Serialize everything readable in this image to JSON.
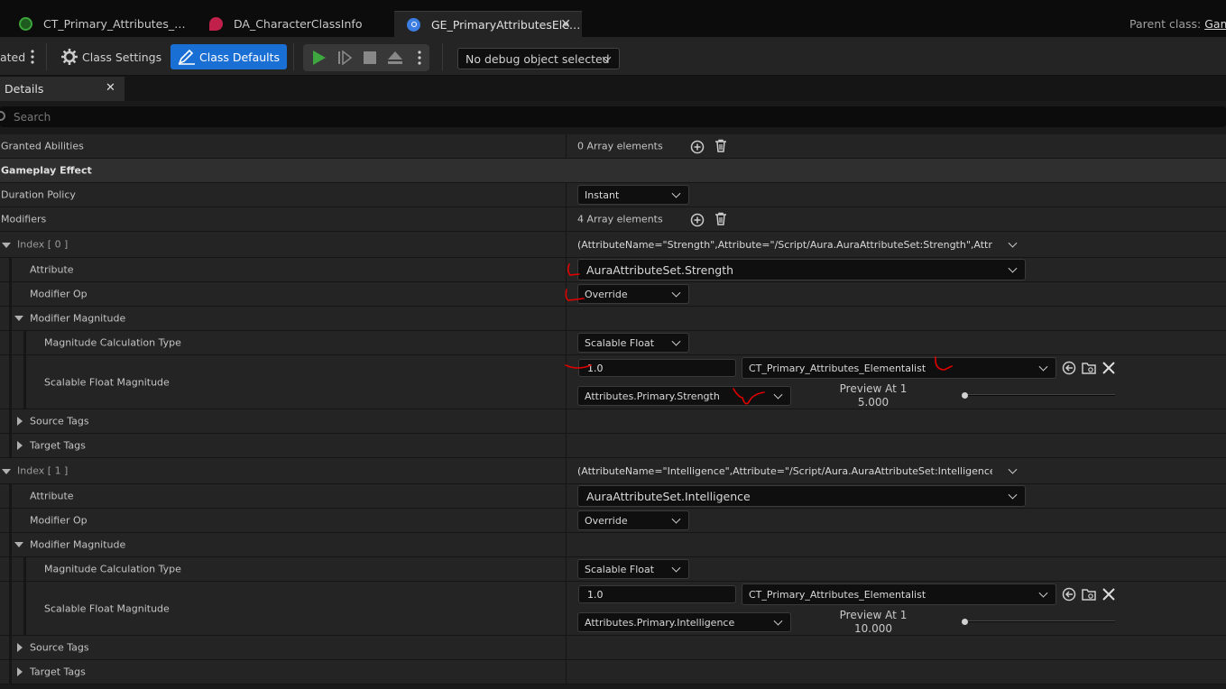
{
  "tabs": [
    {
      "label": "CT_Primary_Attributes_…",
      "icon": "curve-table-icon",
      "color": "#3aa53a"
    },
    {
      "label": "DA_CharacterClassInfo",
      "icon": "data-asset-icon",
      "color": "#c0204a"
    },
    {
      "label": "GE_PrimaryAttributesEle…",
      "icon": "blueprint-icon",
      "color": "#3b7de0",
      "active": true
    }
  ],
  "parent_class": {
    "label": "Parent class:",
    "value": "Gam"
  },
  "toolbar": {
    "cut_label": "ated",
    "class_settings": "Class Settings",
    "class_defaults": "Class Defaults",
    "debug_object": "No debug object selected"
  },
  "details": {
    "tab_label": "Details",
    "search_placeholder": "Search",
    "granted_abilities": {
      "label": "Granted Abilities",
      "value": "0 Array elements"
    },
    "category": "Gameplay Effect",
    "duration_policy": {
      "label": "Duration Policy",
      "value": "Instant"
    },
    "modifiers": {
      "label": "Modifiers",
      "value": "4 Array elements"
    },
    "entries": [
      {
        "index_label": "Index [ 0 ]",
        "summary": "(AttributeName=\"Strength\",Attribute=\"/Script/Aura.AuraAttributeSet:Strength\",AttributeOwn",
        "attribute_label": "Attribute",
        "attribute_value": "AuraAttributeSet.Strength",
        "modop_label": "Modifier Op",
        "modop_value": "Override",
        "magnitude_label": "Modifier Magnitude",
        "calc_type_label": "Magnitude Calculation Type",
        "calc_type_value": "Scalable Float",
        "sfm_label": "Scalable Float Magnitude",
        "sfm_value": "1.0",
        "curve_table": "CT_Primary_Attributes_Elementalist",
        "row_name": "Attributes.Primary.Strength",
        "preview_label": "Preview At 1",
        "preview_value": "5.000",
        "source_tags": "Source Tags",
        "target_tags": "Target Tags"
      },
      {
        "index_label": "Index [ 1 ]",
        "summary": "(AttributeName=\"Intelligence\",Attribute=\"/Script/Aura.AuraAttributeSet:Intelligence\",Attribut",
        "attribute_label": "Attribute",
        "attribute_value": "AuraAttributeSet.Intelligence",
        "modop_label": "Modifier Op",
        "modop_value": "Override",
        "magnitude_label": "Modifier Magnitude",
        "calc_type_label": "Magnitude Calculation Type",
        "calc_type_value": "Scalable Float",
        "sfm_label": "Scalable Float Magnitude",
        "sfm_value": "1.0",
        "curve_table": "CT_Primary_Attributes_Elementalist",
        "row_name": "Attributes.Primary.Intelligence",
        "preview_label": "Preview At 1",
        "preview_value": "10.000",
        "source_tags": "Source Tags",
        "target_tags": "Target Tags"
      }
    ]
  },
  "colors": {
    "accent": "#1a6fd4",
    "annotation": "#e00000",
    "play": "#3ea63e"
  }
}
